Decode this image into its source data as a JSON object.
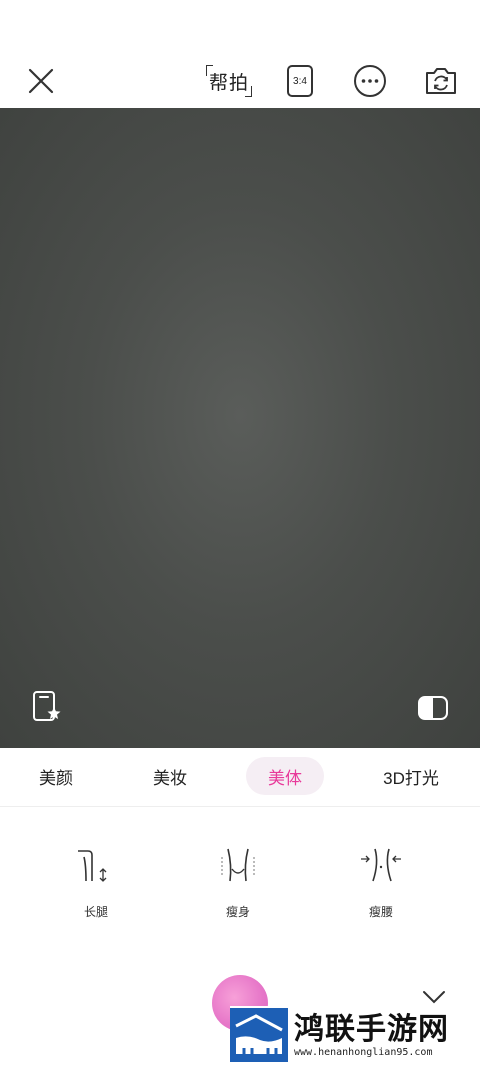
{
  "topbar": {
    "help_label": "帮拍",
    "ratio_label": "3:4"
  },
  "tabs": [
    {
      "label": "美颜",
      "selected": false
    },
    {
      "label": "美妆",
      "selected": false
    },
    {
      "label": "美体",
      "selected": true
    },
    {
      "label": "3D打光",
      "selected": false
    }
  ],
  "tools": [
    {
      "label": "长腿",
      "icon": "long-legs-icon"
    },
    {
      "label": "瘦身",
      "icon": "slim-body-icon"
    },
    {
      "label": "瘦腰",
      "icon": "slim-waist-icon"
    }
  ],
  "colors": {
    "accent": "#e8399a",
    "viewfinder": "#4b4e4b"
  },
  "watermark": {
    "title": "鸿联手游网",
    "url": "www.henanhonglian95.com"
  }
}
